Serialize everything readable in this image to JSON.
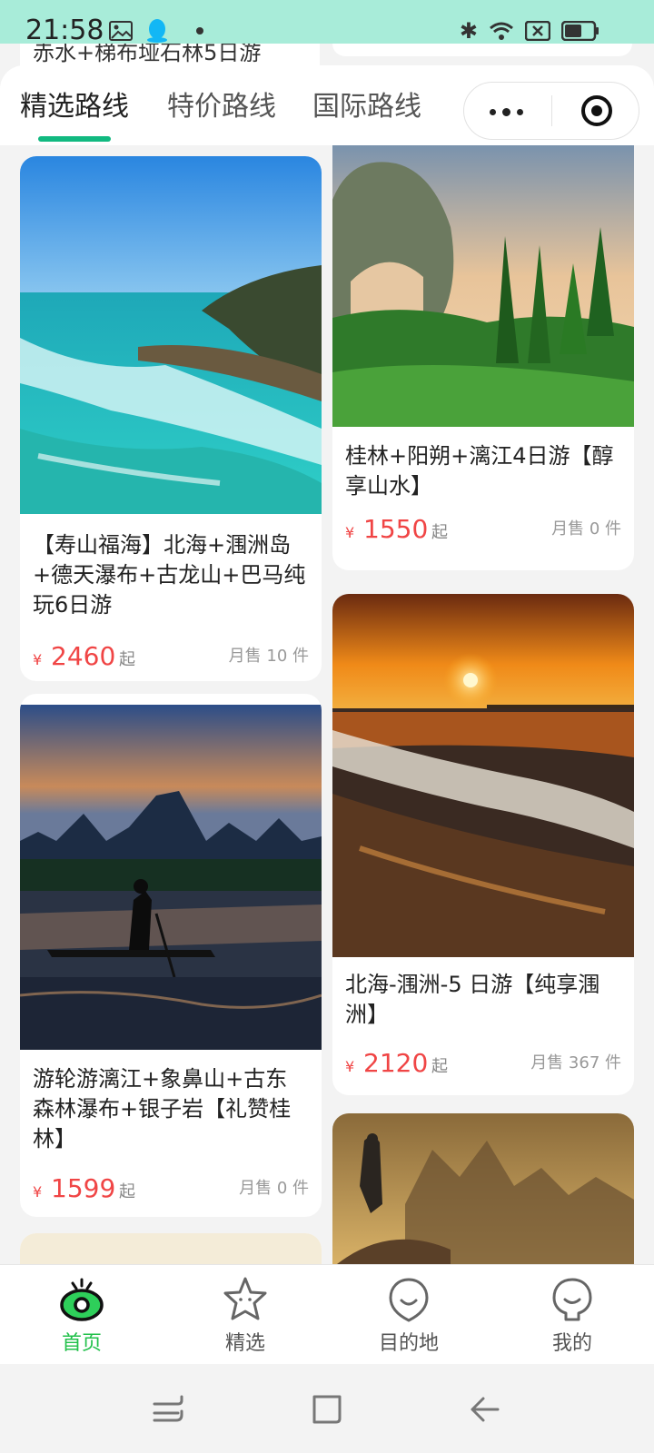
{
  "status_bar": {
    "time": "21:58"
  },
  "peek": {
    "left_title": "赤水+梯布垭石林5日游"
  },
  "tabs": [
    {
      "label": "精选路线",
      "active": true
    },
    {
      "label": "特价路线",
      "active": false
    },
    {
      "label": "国际路线",
      "active": false
    }
  ],
  "cards": [
    {
      "title": "【寿山福海】北海+涠洲岛+德天瀑布+古龙山+巴马纯玩6日游",
      "currency": "¥",
      "price": "2460",
      "suffix": "起",
      "sold": "月售 10 件"
    },
    {
      "title": "桂林+阳朔+漓江4日游【醇享山水】",
      "currency": "¥",
      "price": "1550",
      "suffix": "起",
      "sold": "月售 0 件"
    },
    {
      "title": "游轮游漓江+象鼻山+古东森林瀑布+银子岩【礼赞桂林】",
      "currency": "¥",
      "price": "1599",
      "suffix": "起",
      "sold": "月售 0 件"
    },
    {
      "title": "北海-涠洲-5 日游【纯享涠洲】",
      "currency": "¥",
      "price": "2120",
      "suffix": "起",
      "sold": "月售 367 件"
    }
  ],
  "bottom_nav": [
    {
      "label": "首页",
      "icon": "home-eye-icon",
      "active": true
    },
    {
      "label": "精选",
      "icon": "star-face-icon",
      "active": false
    },
    {
      "label": "目的地",
      "icon": "destination-face-icon",
      "active": false
    },
    {
      "label": "我的",
      "icon": "profile-face-icon",
      "active": false
    }
  ],
  "colors": {
    "accent": "#21c04a",
    "tab_underline": "#11b980",
    "price": "#f04545",
    "status_bar": "#a8ecd9"
  }
}
